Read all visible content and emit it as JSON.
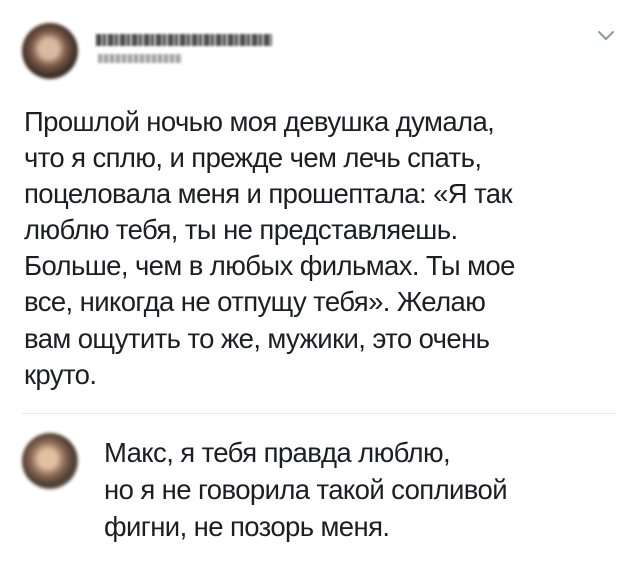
{
  "tweet": {
    "text": "Прошлой ночью моя девушка думала,\nчто я сплю, и прежде чем лечь спать,\nпоцеловала меня и прошептала: «Я так\nлюблю тебя, ты не представляешь.\nБольше, чем в любых фильмах. Ты мое\nвсе, никогда не отпущу тебя». Желаю\nвам ощутить то же, мужики, это очень\nкруто."
  },
  "reply": {
    "text": "Макс, я тебя правда люблю,\nно я не говорила такой сопливой\nфигни, не позорь меня."
  },
  "icons": {
    "menu": "chevron-down-icon"
  },
  "colors": {
    "text": "#1b1f23",
    "divider": "#e6ecf0",
    "icon": "#8b98a5"
  }
}
